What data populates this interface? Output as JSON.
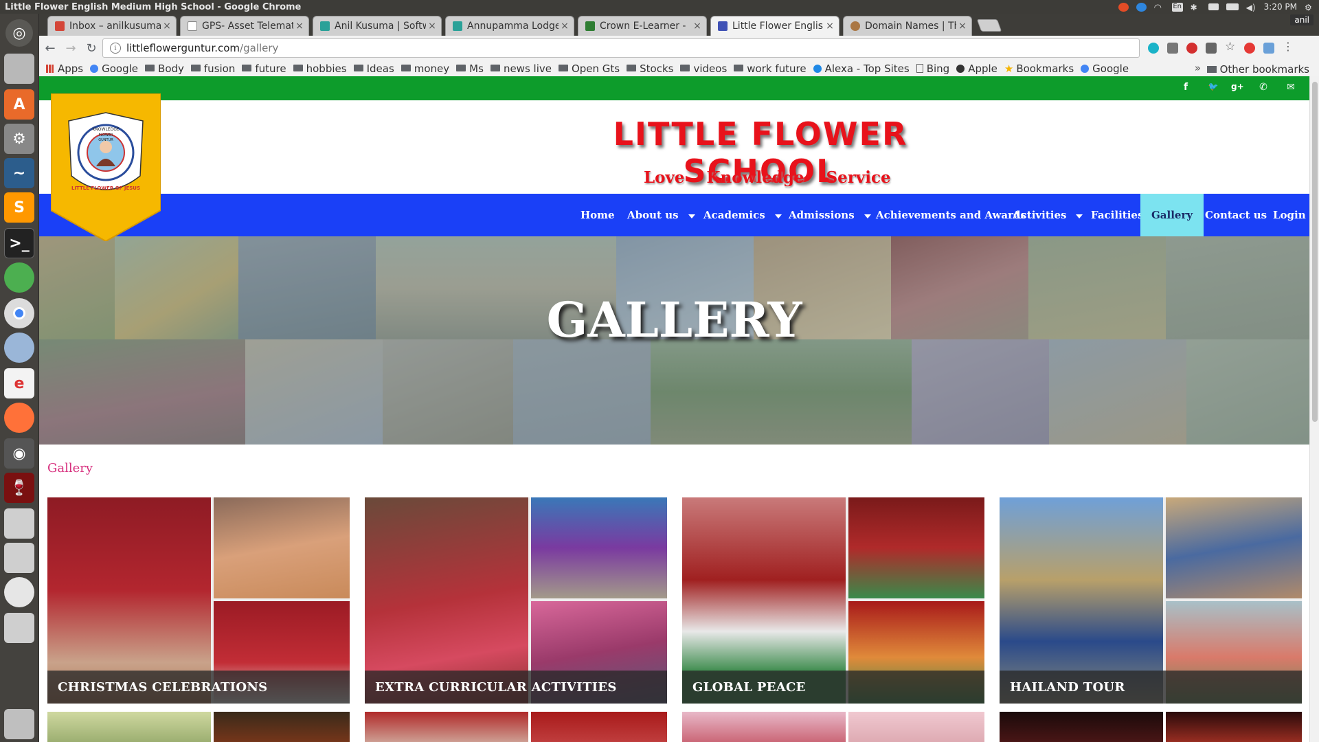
{
  "os": {
    "window_title": "Little Flower English Medium High School - Google Chrome",
    "clock": "3:20 PM",
    "user": "anil",
    "keyboard_layout": "En"
  },
  "browser": {
    "tabs": [
      {
        "label": "Inbox – anilkusuma",
        "color": "#d44638"
      },
      {
        "label": "GPS- Asset Telemat",
        "color": "#888888"
      },
      {
        "label": "Anil Kusuma | Softw",
        "color": "#2aa198"
      },
      {
        "label": "Annupamma Lodge",
        "color": "#2aa198"
      },
      {
        "label": "Crown E-Learner -",
        "color": "#2e7d32"
      },
      {
        "label": "Little Flower Englis",
        "color": "#3f51b5"
      },
      {
        "label": "Domain Names | Th",
        "color": "#aa7744"
      }
    ],
    "url_host": "littleflowerguntur.com",
    "url_path": "/gallery",
    "bookmarks": [
      "Apps",
      "Google",
      "Body",
      "fusion",
      "future",
      "hobbies",
      "Ideas",
      "money",
      "Ms",
      "news live",
      "Open Gts",
      "Stocks",
      "videos",
      "work future",
      "Alexa - Top Sites",
      "Bing",
      "Apple",
      "Bookmarks",
      "Google"
    ],
    "other_bookmarks": "Other bookmarks",
    "overflow": "»"
  },
  "site": {
    "school_name": "LITTLE FLOWER SCHOOL",
    "motto": [
      "Love",
      "Knowledge",
      "Service"
    ],
    "logo_text_top": "KNOWLEDGE",
    "logo_text_mid": "FLOWER",
    "logo_text_city": "GUNTUR",
    "logo_text_bottom": "LITTLE FLOWER OF JESUS",
    "social": [
      "f",
      "t",
      "g+",
      "phone",
      "mail"
    ],
    "nav": [
      {
        "label": "Home",
        "dropdown": false
      },
      {
        "label": "About us",
        "dropdown": true
      },
      {
        "label": "Academics",
        "dropdown": true
      },
      {
        "label": "Admissions",
        "dropdown": true
      },
      {
        "label": "Achievements and Awards",
        "dropdown": false
      },
      {
        "label": "Activities",
        "dropdown": true
      },
      {
        "label": "Facilities",
        "dropdown": false
      },
      {
        "label": "Gallery",
        "dropdown": false,
        "active": true
      },
      {
        "label": "Contact us",
        "dropdown": false
      },
      {
        "label": "Login",
        "dropdown": false
      }
    ],
    "hero_title": "GALLERY",
    "breadcrumb": "Gallery",
    "gallery": [
      {
        "title": "CHRISTMAS CELEBRATIONS"
      },
      {
        "title": "EXTRA CURRICULAR ACTIVITIES"
      },
      {
        "title": "GLOBAL PEACE"
      },
      {
        "title": "HAILAND TOUR"
      }
    ],
    "colors": {
      "green_bar": "#0d9c2b",
      "nav_blue": "#1a40f7",
      "active_nav": "#7ce3f0",
      "brand_red": "#e8121b",
      "breadcrumb": "#d7307e"
    }
  }
}
